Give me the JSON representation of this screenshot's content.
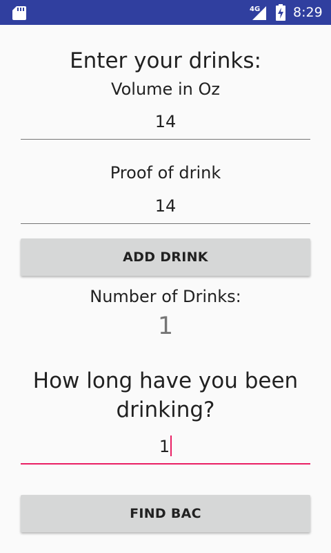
{
  "status_bar": {
    "network_type": "4G",
    "time": "8:29",
    "icons": [
      "sd-card-icon",
      "signal-icon",
      "battery-charging-icon"
    ],
    "background_color": "#303f9f"
  },
  "form": {
    "heading": "Enter your drinks:",
    "volume": {
      "label": "Volume in Oz",
      "value": "14"
    },
    "proof": {
      "label": "Proof of drink",
      "value": "14"
    },
    "add_drink_button": "ADD DRINK",
    "drink_count": {
      "label": "Number of Drinks:",
      "value": "1"
    },
    "duration": {
      "question": "How long have you been drinking?",
      "value": "1"
    },
    "find_bac_button": "FIND BAC"
  },
  "colors": {
    "accent": "#e91e63",
    "button_background": "#d6d7d7",
    "page_background": "#fafafa"
  }
}
